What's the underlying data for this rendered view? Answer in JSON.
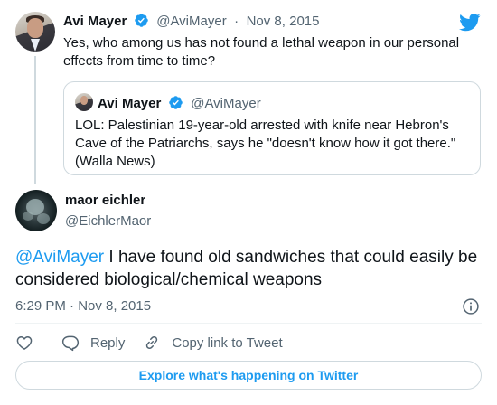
{
  "parent_tweet": {
    "name": "Avi Mayer",
    "handle": "@AviMayer",
    "separator": "·",
    "date": "Nov 8, 2015",
    "text": "Yes, who among us has not found a lethal weapon in our personal effects from time to time?",
    "verified_icon": "verified-badge-icon",
    "avatar": "profile-photo"
  },
  "quoted_tweet": {
    "name": "Avi Mayer",
    "handle": "@AviMayer",
    "text": "LOL: Palestinian 19-year-old arrested with knife near Hebron's Cave of the Patriarchs, says he \"doesn't know how it got there.\" (Walla News)"
  },
  "main_tweet": {
    "name": "maor eichler",
    "handle": "@EichlerMaor",
    "mention": "@AviMayer",
    "text": " I have found old sandwiches that could easily be considered biological/chemical weapons",
    "timestamp": "6:29 PM · Nov 8, 2015"
  },
  "actions": {
    "reply_label": "Reply",
    "copy_label": "Copy link to Tweet"
  },
  "explore_label": "Explore what's happening on Twitter",
  "colors": {
    "accent": "#1d9bf0",
    "text": "#0f1419",
    "secondary": "#536471",
    "border": "#cfd9de"
  },
  "icons": [
    "twitter-logo-icon",
    "verified-badge-icon",
    "info-icon",
    "heart-icon",
    "reply-icon",
    "link-icon"
  ]
}
